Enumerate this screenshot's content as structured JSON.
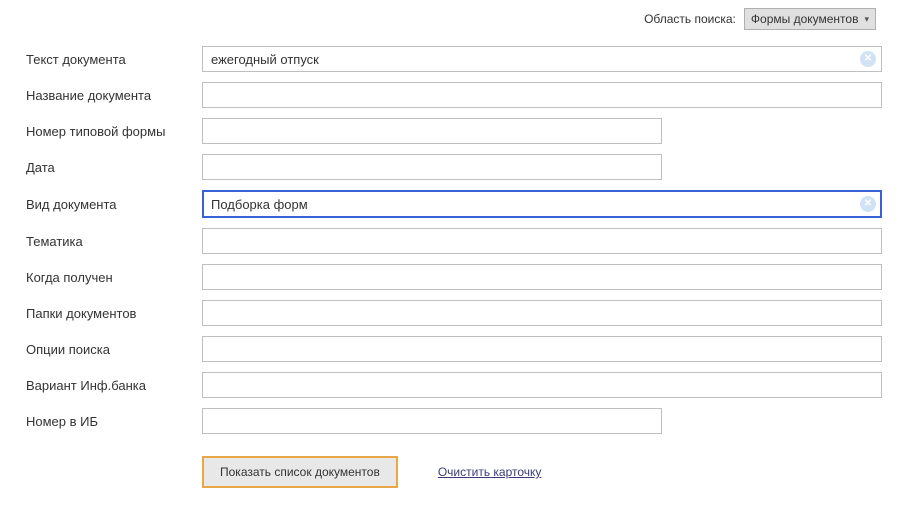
{
  "top": {
    "scope_label": "Область поиска:",
    "scope_value": "Формы документов"
  },
  "fields": {
    "text": {
      "label": "Текст документа",
      "value": "ежегодный отпуск"
    },
    "name": {
      "label": "Название документа",
      "value": ""
    },
    "form_number": {
      "label": "Номер типовой формы",
      "value": ""
    },
    "date": {
      "label": "Дата",
      "value": ""
    },
    "kind": {
      "label": "Вид документа",
      "value": "Подборка форм"
    },
    "topic": {
      "label": "Тематика",
      "value": ""
    },
    "received": {
      "label": "Когда получен",
      "value": ""
    },
    "folders": {
      "label": "Папки документов",
      "value": ""
    },
    "options": {
      "label": "Опции поиска",
      "value": ""
    },
    "bank_variant": {
      "label": "Вариант Инф.банка",
      "value": ""
    },
    "ib_number": {
      "label": "Номер в ИБ",
      "value": ""
    }
  },
  "buttons": {
    "submit": "Показать список документов",
    "clear": "Очистить карточку"
  }
}
